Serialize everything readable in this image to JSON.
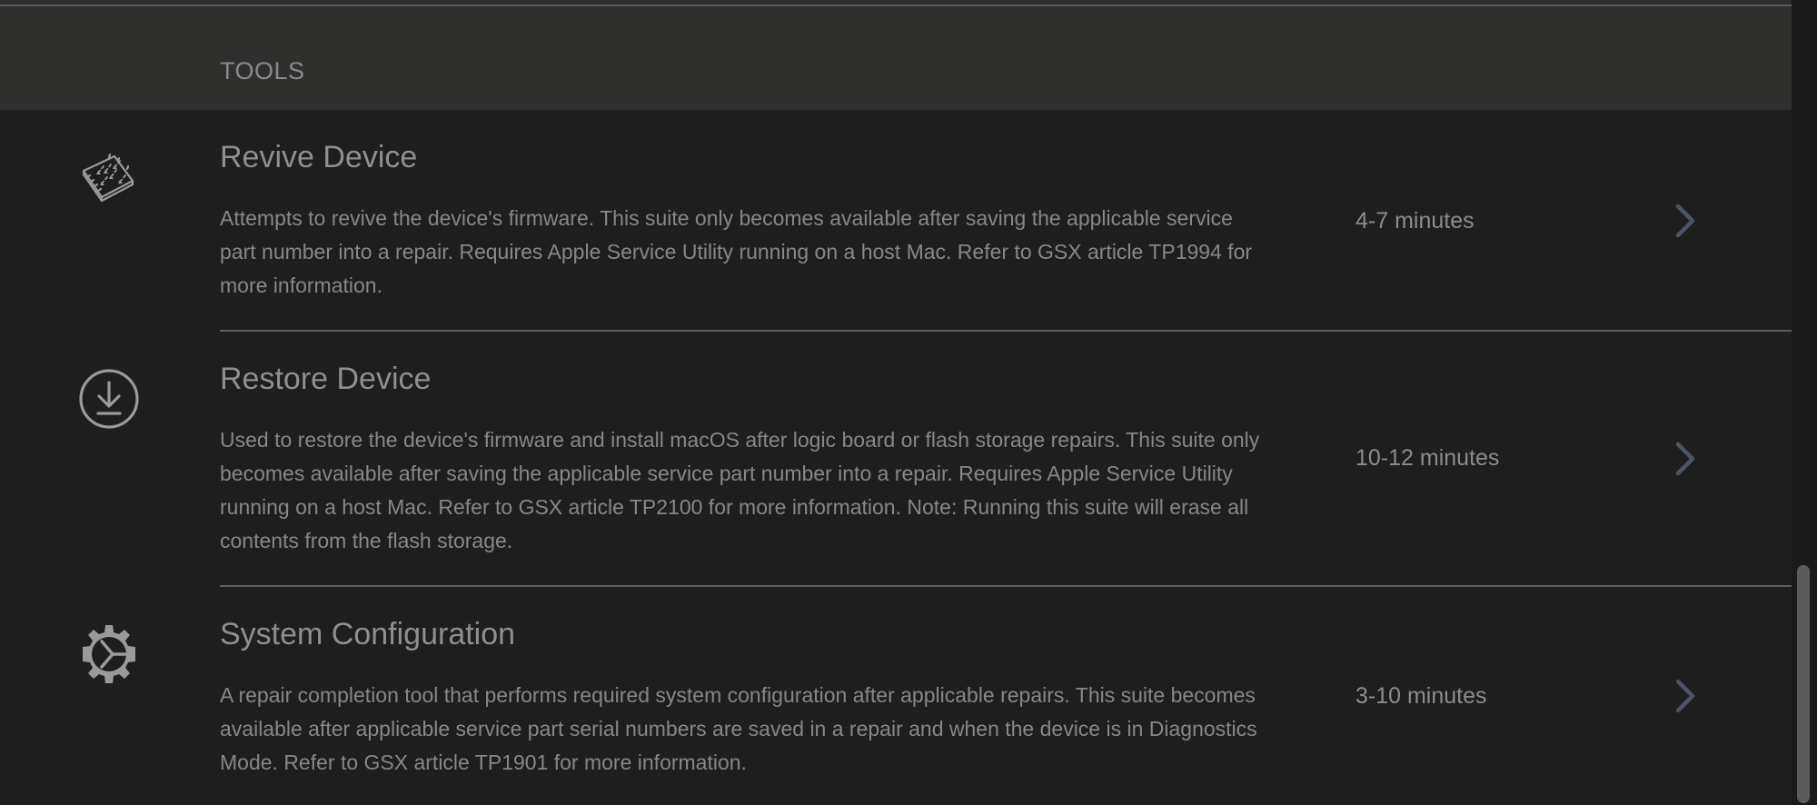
{
  "section": {
    "title": "TOOLS"
  },
  "tools": [
    {
      "title": "Revive Device",
      "description": "Attempts to revive the device's firmware. This suite only becomes available after saving the applicable service part number into a repair. Requires Apple Service Utility running on a host Mac. Refer to GSX article TP1994 for more information.",
      "duration": "4-7 minutes",
      "icon": "chip-revive-icon"
    },
    {
      "title": "Restore Device",
      "description": "Used to restore the device's firmware and install macOS after logic board or flash storage repairs. This suite only becomes available after saving the applicable service part number into a repair. Requires Apple Service Utility running on a host Mac. Refer to GSX article TP2100 for more information. Note: Running this suite will erase all contents from the flash storage.",
      "duration": "10-12 minutes",
      "icon": "download-circle-icon"
    },
    {
      "title": "System Configuration",
      "description": "A repair completion tool that performs required system configuration after applicable repairs. This suite becomes available after applicable service part serial numbers are saved in a repair and when the device is in Diagnostics Mode. Refer to GSX article TP1901 for more information.",
      "duration": "3-10 minutes",
      "icon": "gear-icon"
    }
  ],
  "colors": {
    "background": "#1e1e1e",
    "header_background": "#2f2f2e",
    "chevron": "#4c5468",
    "divider": "#5e5e5e"
  }
}
